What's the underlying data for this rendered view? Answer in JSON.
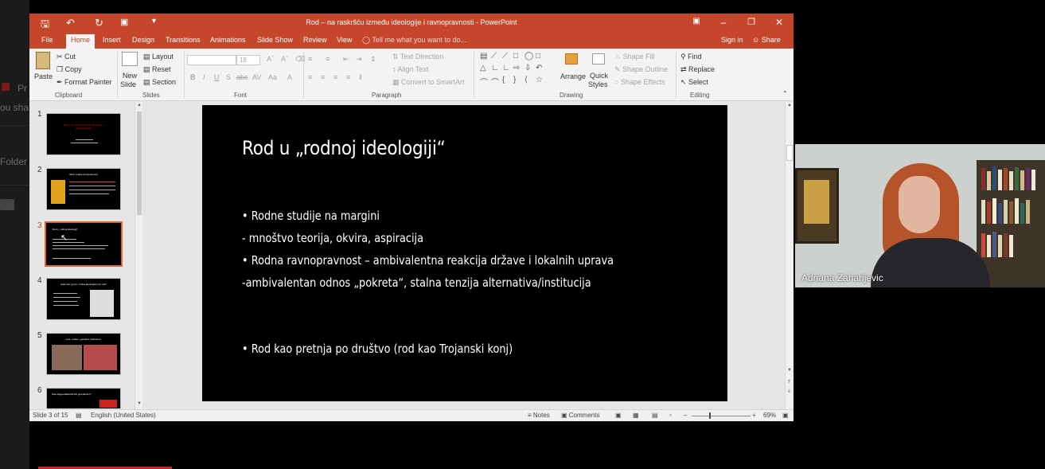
{
  "background_app": {
    "labels": [
      "Pr",
      "ou sha",
      "Folder"
    ]
  },
  "window": {
    "title": "Rod – na raskršću između ideologije i ravnopravnosti - PowerPoint",
    "accent_color": "#c6462b"
  },
  "quick_access": {
    "save_icon": "save-icon",
    "undo_icon": "undo-icon",
    "redo_icon": "redo-icon",
    "present_icon": "present-icon"
  },
  "tabs": [
    {
      "label": "File"
    },
    {
      "label": "Home"
    },
    {
      "label": "Insert"
    },
    {
      "label": "Design"
    },
    {
      "label": "Transitions"
    },
    {
      "label": "Animations"
    },
    {
      "label": "Slide Show"
    },
    {
      "label": "Review"
    },
    {
      "label": "View"
    }
  ],
  "tell_me": "Tell me what you want to do...",
  "account": {
    "sign_in": "Sign in",
    "share": "Share"
  },
  "ribbon": {
    "clipboard": {
      "paste": "Paste",
      "cut": "Cut",
      "copy": "Copy",
      "format_painter": "Format Painter",
      "label": "Clipboard"
    },
    "slides": {
      "new_slide_1": "New",
      "new_slide_2": "Slide",
      "layout": "Layout",
      "reset": "Reset",
      "section": "Section",
      "label": "Slides"
    },
    "font": {
      "font_size": "18",
      "bold": "B",
      "italic": "I",
      "underline": "U",
      "shadow": "S",
      "strike": "abc",
      "spacing": "AV",
      "case": "Aa",
      "color": "A",
      "label": "Font"
    },
    "paragraph": {
      "text_direction": "Text Direction",
      "align_text": "Align Text",
      "convert_smartart": "Convert to SmartArt",
      "label": "Paragraph"
    },
    "drawing": {
      "arrange": "Arrange",
      "quick_styles_1": "Quick",
      "quick_styles_2": "Styles",
      "shape_fill": "Shape Fill",
      "shape_outline": "Shape Outline",
      "shape_effects": "Shape Effects",
      "label": "Drawing"
    },
    "editing": {
      "find": "Find",
      "replace": "Replace",
      "select": "Select",
      "label": "Editing"
    }
  },
  "thumbnails": [
    {
      "num": "1",
      "title": "Rod – na raskršću između ideologije i ravnopravnosti"
    },
    {
      "num": "2",
      "title": "Rod i rodna ravnopravnost"
    },
    {
      "num": "3",
      "title": "Rod u „rodnoj ideologiji“"
    },
    {
      "num": "4",
      "title": "Kako bez grozo i rodna ideologija kroz rod?"
    },
    {
      "num": "5",
      "title": "Lere, rodne i „gendere rodnosmo“"
    },
    {
      "num": "6",
      "title": "Gde diigspodilitacioli biti grenderiscr?"
    }
  ],
  "slide": {
    "title": "Rod u „rodnoj ideologiji“",
    "lines": [
      "• Rodne studije na margini",
      "- mnoštvo teorija, okvira, aspiracija",
      "• Rodna ravnopravnost – ambivalentna reakcija države i lokalnih uprava",
      "-ambivalentan odnos „pokreta“, stalna tenzija alternativa/institucija",
      "• Rod kao pretnja po društvo (rod kao Trojanski konj)"
    ]
  },
  "status": {
    "slide_count": "Slide 3 of 15",
    "language": "English (United States)",
    "notes": "Notes",
    "comments": "Comments",
    "zoom": "69%"
  },
  "video": {
    "participant_name": "Adriana Zaharijevic"
  }
}
